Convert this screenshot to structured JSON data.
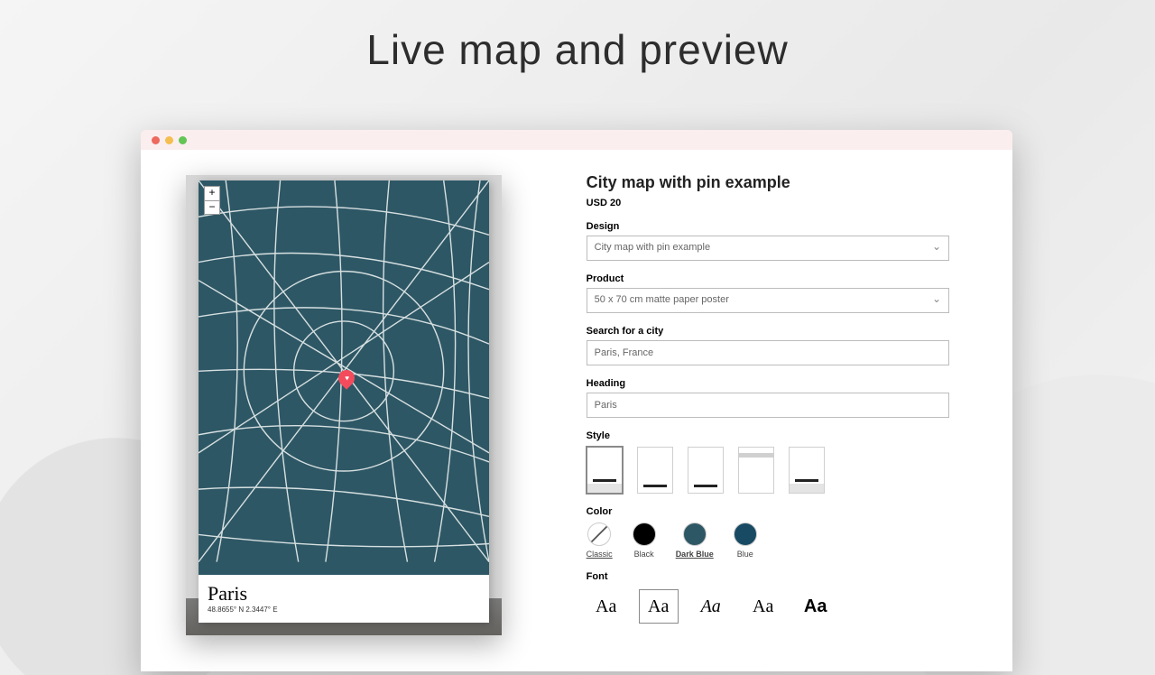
{
  "page_title": "Live map and preview",
  "product": {
    "title": "City map with pin example",
    "price": "USD 20"
  },
  "fields": {
    "design": {
      "label": "Design",
      "value": "City map with pin example"
    },
    "product": {
      "label": "Product",
      "value": "50 x 70 cm matte paper poster"
    },
    "city": {
      "label": "Search for a city",
      "value": "Paris, France"
    },
    "heading": {
      "label": "Heading",
      "value": "Paris"
    },
    "style": {
      "label": "Style"
    },
    "color": {
      "label": "Color"
    },
    "font": {
      "label": "Font"
    }
  },
  "colors": [
    {
      "name": "Classic",
      "key": "classic"
    },
    {
      "name": "Black",
      "key": "black"
    },
    {
      "name": "Dark Blue",
      "key": "dark-blue",
      "selected": true
    },
    {
      "name": "Blue",
      "key": "blue"
    }
  ],
  "font_sample": "Aa",
  "poster": {
    "city": "Paris",
    "coords": "48.8655° N 2.3447° E"
  },
  "zoom": {
    "in": "+",
    "out": "−"
  }
}
